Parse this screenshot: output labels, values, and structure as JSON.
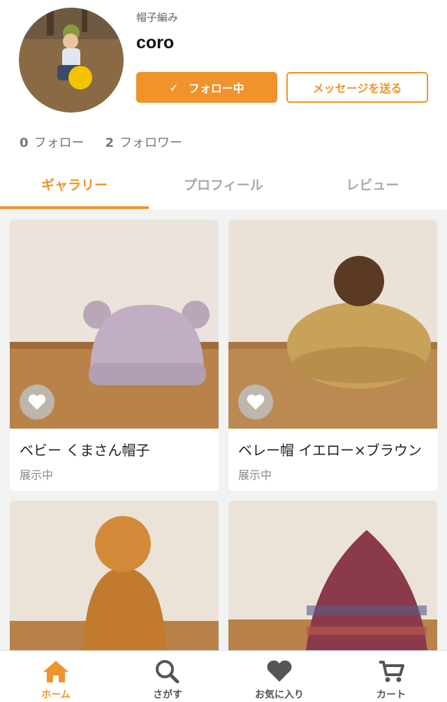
{
  "profile": {
    "category": "帽子編み",
    "username": "coro",
    "follow_button": "フォロー中",
    "message_button": "メッセージを送る",
    "following_count": "0",
    "following_label": "フォロー",
    "followers_count": "2",
    "followers_label": "フォロワー"
  },
  "tabs": [
    "ギャラリー",
    "プロフィール",
    "レビュー"
  ],
  "gallery": [
    {
      "title": "ベビー くまさん帽子",
      "status": "展示中"
    },
    {
      "title": "ベレー帽 イエロー×ブラウン",
      "status": "展示中"
    },
    {
      "title": "",
      "status": ""
    },
    {
      "title": "",
      "status": ""
    }
  ],
  "tabbar": [
    "ホーム",
    "さがす",
    "お気に入り",
    "カート"
  ],
  "colors": {
    "accent": "#f0932b"
  }
}
